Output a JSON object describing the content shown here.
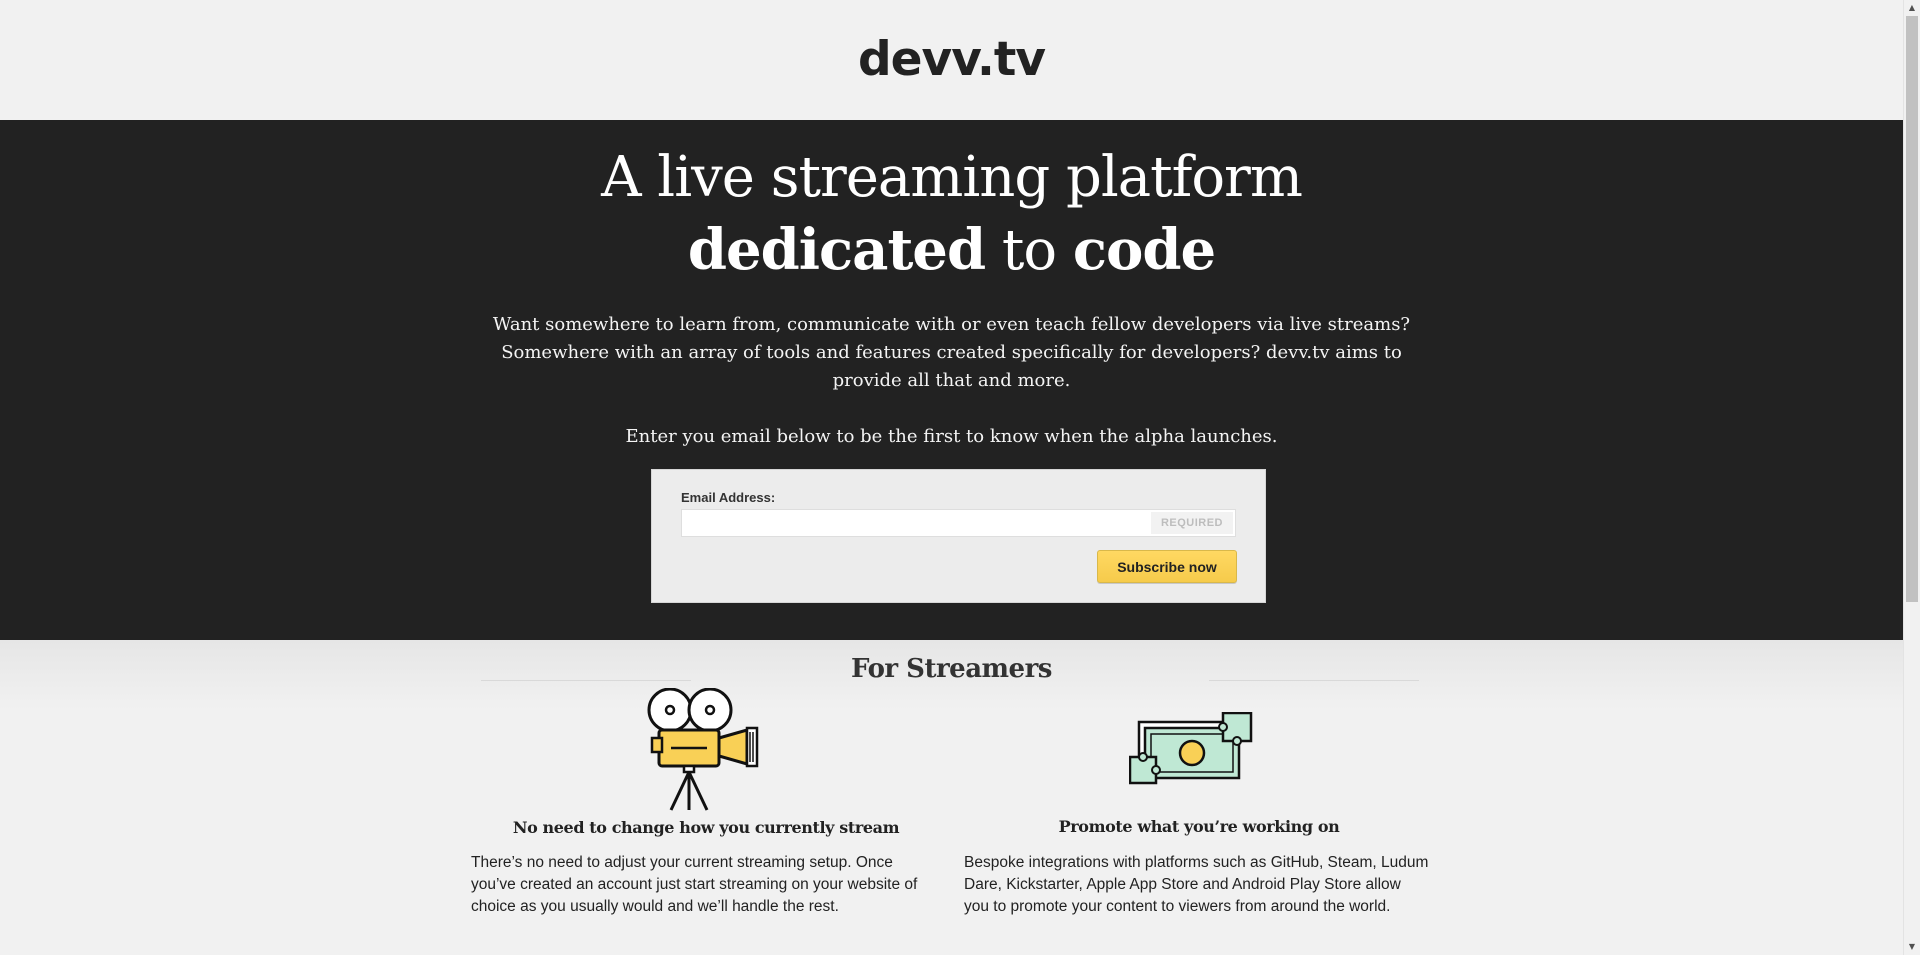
{
  "header": {
    "logo": "devv.tv"
  },
  "hero": {
    "title_line1": "A live streaming platform",
    "title_word_dedicated": "dedicated",
    "title_word_to": " to ",
    "title_word_code": "code",
    "description": "Want somewhere to learn from, communicate with or even teach fellow developers via live streams? Somewhere with an array of tools and features created specifically for developers? devv.tv aims to provide all that and more.",
    "cta": "Enter you email below to be the first to know when the alpha launches."
  },
  "subscribe": {
    "email_label": "Email Address:",
    "email_value": "",
    "required_tag": "REQUIRED",
    "button_label": "Subscribe now",
    "button_color": "#f9d056"
  },
  "streamers": {
    "title": "For Streamers",
    "features": [
      {
        "icon": "movie-camera-icon",
        "title": "No need to change how you currently stream",
        "text": "There’s no need to adjust your current streaming setup. Once you’ve created an account just start streaming on your website of choice as you usually would and we’ll handle the rest."
      },
      {
        "icon": "money-puzzle-icon",
        "title": "Promote what you’re working on",
        "text": "Bespoke integrations with platforms such as GitHub, Steam, Ludum Dare, Kickstarter, Apple App Store and Android Play Store allow you to promote your content to viewers from around the world."
      }
    ]
  },
  "colors": {
    "hero_bg": "#222222",
    "page_bg": "#f1f1f1",
    "accent_yellow": "#f9d056",
    "accent_mint": "#bfe8d4"
  }
}
